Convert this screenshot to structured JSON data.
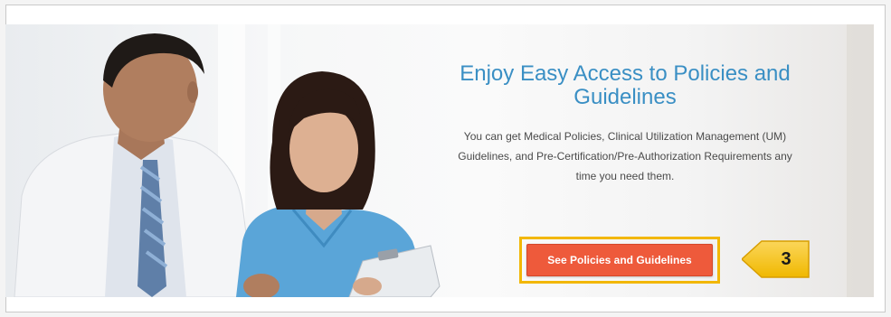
{
  "hero": {
    "headline": "Enjoy Easy Access to Policies and Guidelines",
    "body": "You can get Medical Policies, Clinical Utilization Management (UM) Guidelines, and Pre-Certification/Pre-Authorization Requirements any time you need them.",
    "cta_label": "See Policies and Guidelines"
  },
  "callout": {
    "step_number": "3"
  },
  "colors": {
    "headline": "#3a8fc4",
    "cta": "#ee5a3b",
    "highlight": "#f2b705"
  }
}
